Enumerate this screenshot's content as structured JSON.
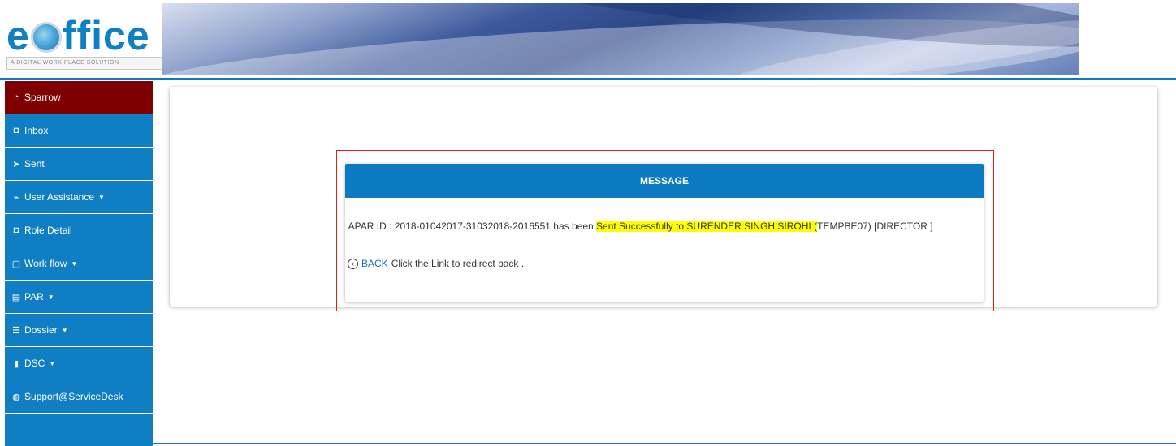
{
  "header": {
    "logo_text": "eOffice",
    "logo_tagline": "A DIGITAL WORK PLACE SOLUTION"
  },
  "sidebar": {
    "items": [
      {
        "label": "Sparrow",
        "icon": "dashboard-icon",
        "glyph": "◔",
        "active": true,
        "dropdown": false
      },
      {
        "label": "Inbox",
        "icon": "inbox-icon",
        "glyph": "◘",
        "active": false,
        "dropdown": false
      },
      {
        "label": "Sent",
        "icon": "send-icon",
        "glyph": "➤",
        "active": false,
        "dropdown": false
      },
      {
        "label": "User Assistance",
        "icon": "line-chart-icon",
        "glyph": "⌁",
        "active": false,
        "dropdown": true
      },
      {
        "label": "Role Detail",
        "icon": "inbox-icon",
        "glyph": "◘",
        "active": false,
        "dropdown": false
      },
      {
        "label": "Work flow",
        "icon": "file-icon",
        "glyph": "▢",
        "active": false,
        "dropdown": true
      },
      {
        "label": "PAR",
        "icon": "file-text-icon",
        "glyph": "▤",
        "active": false,
        "dropdown": true
      },
      {
        "label": "Dossier",
        "icon": "list-icon",
        "glyph": "☰",
        "active": false,
        "dropdown": true
      },
      {
        "label": "DSC",
        "icon": "file-filled-icon",
        "glyph": "▮",
        "active": false,
        "dropdown": true
      },
      {
        "label": "Support@ServiceDesk",
        "icon": "globe-icon",
        "glyph": "◍",
        "active": false,
        "dropdown": false
      }
    ],
    "caret": "▼"
  },
  "message": {
    "title": "MESSAGE",
    "text_before": "APAR ID : 2018-01042017-31032018-2016551 has been ",
    "text_highlight": "Sent Successfully to SURENDER SINGH SIROHI (",
    "text_after": "TEMPBE07) [DIRECTOR ]",
    "back_icon": "chevron-left-circle-icon",
    "back_glyph": "‹",
    "back_link": "BACK",
    "back_text": "Click the Link to redirect back ."
  },
  "colors": {
    "primary": "#0f7ec3",
    "active_nav": "#7f0000",
    "highlight": "#ffff00",
    "frame_red": "#e02020",
    "link": "#1a6fc0"
  }
}
